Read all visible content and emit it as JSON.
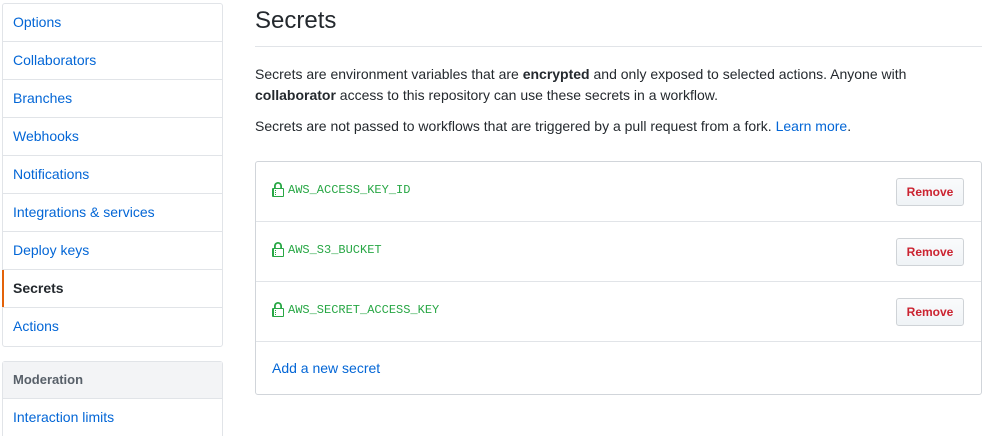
{
  "sidebar": {
    "items": [
      {
        "label": "Options",
        "selected": false
      },
      {
        "label": "Collaborators",
        "selected": false
      },
      {
        "label": "Branches",
        "selected": false
      },
      {
        "label": "Webhooks",
        "selected": false
      },
      {
        "label": "Notifications",
        "selected": false
      },
      {
        "label": "Integrations & services",
        "selected": false
      },
      {
        "label": "Deploy keys",
        "selected": false
      },
      {
        "label": "Secrets",
        "selected": true
      },
      {
        "label": "Actions",
        "selected": false
      }
    ],
    "moderation": {
      "heading": "Moderation",
      "items": [
        {
          "label": "Interaction limits"
        }
      ]
    }
  },
  "main": {
    "title": "Secrets",
    "description": {
      "part1": "Secrets are environment variables that are ",
      "bold1": "encrypted",
      "part2": " and only exposed to selected actions. Anyone with",
      "bold2": "collaborator",
      "part3": " access to this repository can use these secrets in a workflow."
    },
    "note": {
      "text": "Secrets are not passed to workflows that are triggered by a pull request from a fork. ",
      "link": "Learn more",
      "end": "."
    },
    "secrets": [
      {
        "name": "AWS_ACCESS_KEY_ID",
        "remove_label": "Remove",
        "icon": "lock-icon"
      },
      {
        "name": "AWS_S3_BUCKET",
        "remove_label": "Remove",
        "icon": "lock-icon"
      },
      {
        "name": "AWS_SECRET_ACCESS_KEY",
        "remove_label": "Remove",
        "icon": "lock-icon"
      }
    ],
    "add_secret_label": "Add a new secret"
  },
  "colors": {
    "link": "#0366d6",
    "secret_green": "#28a745",
    "danger": "#cb2431",
    "selected_bar": "#e36209"
  }
}
